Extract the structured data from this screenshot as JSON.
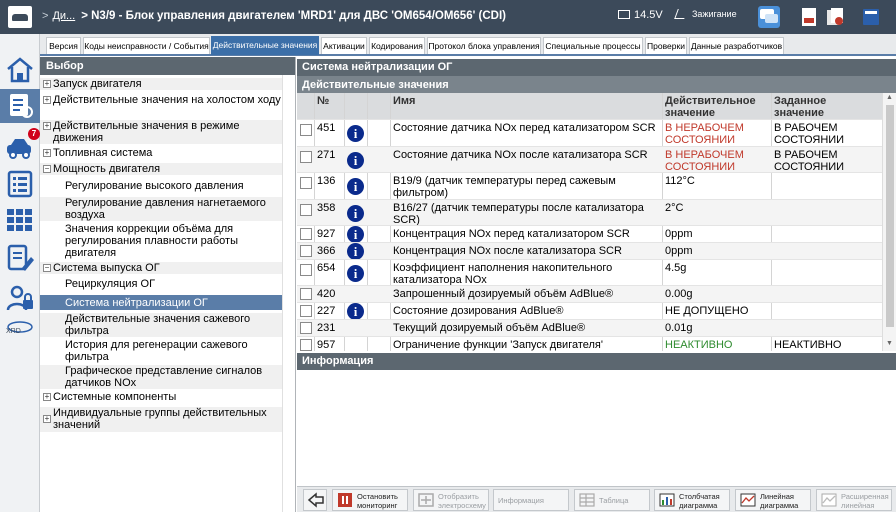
{
  "header": {
    "crumb_prefix": ">",
    "crumb_link": "Ди...",
    "title": "> N3/9 - Блок управления двигателем 'MRD1' для ДВС 'OM654/OM656' (CDI)",
    "voltage": "14.5V",
    "ignition_label": "Зажигание"
  },
  "sidebar": {
    "badge_count": "7",
    "xrd_label": "XRD"
  },
  "tabs": [
    {
      "label": "Версия"
    },
    {
      "label": "Коды неисправности / События"
    },
    {
      "label": "Действительные значения"
    },
    {
      "label": "Активации"
    },
    {
      "label": "Кодирования"
    },
    {
      "label": "Протокол блока управления"
    },
    {
      "label": "Специальные процессы"
    },
    {
      "label": "Проверки"
    },
    {
      "label": "Данные разработчиков"
    }
  ],
  "selection": {
    "title": "Выбор",
    "items": [
      {
        "label": "Запуск двигателя"
      },
      {
        "label": "Действительные значения на холостом ходу"
      },
      {
        "label": "Действительные значения в режиме движения"
      },
      {
        "label": "Топливная система"
      },
      {
        "label": "Мощность двигателя"
      },
      {
        "label": "Регулирование высокого давления"
      },
      {
        "label": "Регулирование давления нагнетаемого воздуха"
      },
      {
        "label": "Значения коррекции объёма для регулирования плавности работы двигателя"
      },
      {
        "label": "Система выпуска ОГ"
      },
      {
        "label": "Рециркуляция ОГ"
      },
      {
        "label": "Система нейтрализации ОГ"
      },
      {
        "label": "Действительные значения сажевого фильтра"
      },
      {
        "label": "История для регенерации сажевого фильтра"
      },
      {
        "label": "Графическое представление сигналов датчиков NOx"
      },
      {
        "label": "Системные компоненты"
      },
      {
        "label": "Индивидуальные группы действительных значений"
      }
    ]
  },
  "main": {
    "section_title": "Система нейтрализации ОГ",
    "subsection_title": "Действительные значения",
    "columns": {
      "no": "№",
      "name": "Имя",
      "actual": "Действительное значение",
      "target": "Заданное значение"
    },
    "rows": [
      {
        "no": "451",
        "name": "Состояние датчика NOx перед катализатором SCR",
        "actual": "В НЕРАБОЧЕМ СОСТОЯНИИ",
        "target": "В РАБОЧЕМ СОСТОЯНИИ"
      },
      {
        "no": "271",
        "name": "Состояние датчика NOx после катализатора SCR",
        "actual": "В НЕРАБОЧЕМ СОСТОЯНИИ",
        "target": "В РАБОЧЕМ СОСТОЯНИИ"
      },
      {
        "no": "136",
        "name": "B19/9 (датчик температуры перед сажевым фильтром)",
        "actual": "112°C",
        "target": ""
      },
      {
        "no": "358",
        "name": "B16/27 (датчик температуры после катализатора SCR)",
        "actual": "2°C",
        "target": ""
      },
      {
        "no": "927",
        "name": "Концентрация NOx перед катализатором SCR",
        "actual": "0ppm",
        "target": ""
      },
      {
        "no": "366",
        "name": "Концентрация NOx после катализатора SCR",
        "actual": "0ppm",
        "target": ""
      },
      {
        "no": "654",
        "name": "Коэффициент наполнения накопительного катализатора NOx",
        "actual": "4.5g",
        "target": ""
      },
      {
        "no": "420",
        "name": "Запрошенный дозируемый объём AdBlue®",
        "actual": "0.00g",
        "target": ""
      },
      {
        "no": "227",
        "name": "Состояние дозирования AdBlue®",
        "actual": "НЕ ДОПУЩЕНО",
        "target": ""
      },
      {
        "no": "231",
        "name": "Текущий дозируемый объём AdBlue®",
        "actual": "0.01g",
        "target": ""
      },
      {
        "no": "957",
        "name": "Ограничение функции 'Запуск двигателя'",
        "actual": "НЕАКТИВНО",
        "target": "НЕАКТИВНО"
      }
    ],
    "info_title": "Информация"
  },
  "toolbar": {
    "stop": "Остановить мониторинг",
    "show_diagram": "Отобразить электросхему",
    "info": "Информация",
    "table": "Таблица",
    "bar_chart": "Столбчатая диаграмма",
    "line_chart": "Линейная диаграмма",
    "ext_line_chart": "Расширенная линейная"
  },
  "colors": {
    "accent": "#3c6fa8",
    "header_bg": "#3c4a5a",
    "error_red": "#c0392b",
    "ok_green": "#2e8b2e",
    "info_blue": "#0a2a8c"
  }
}
